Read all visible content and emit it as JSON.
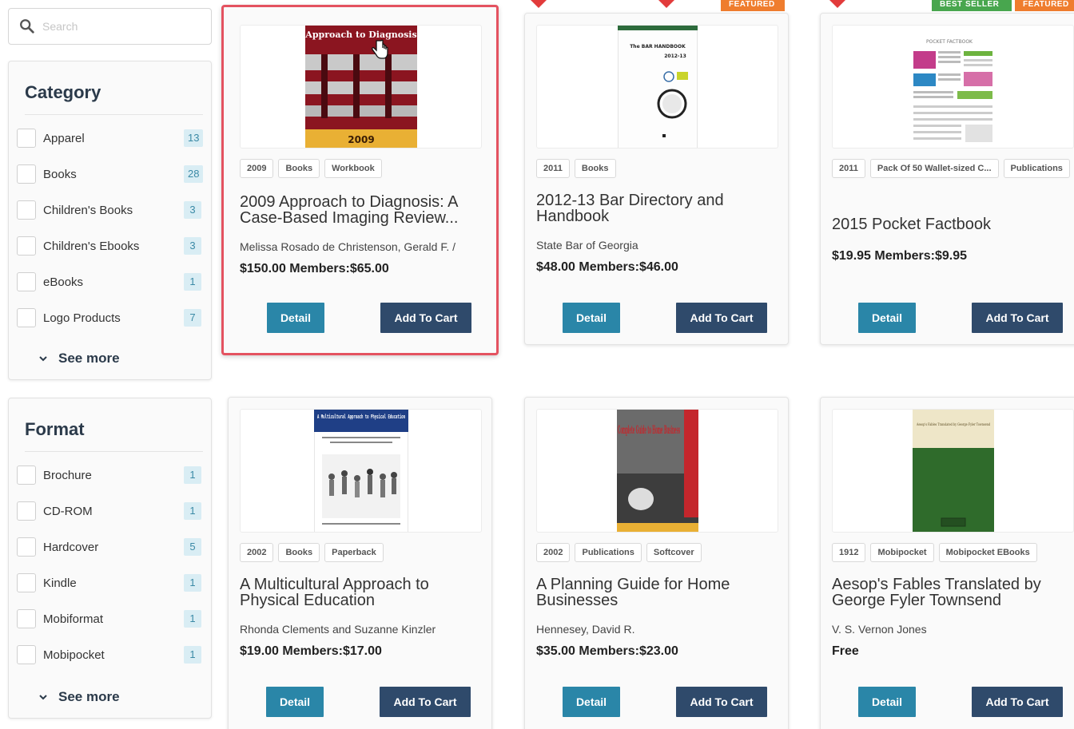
{
  "search": {
    "placeholder": "Search"
  },
  "category": {
    "title": "Category",
    "items": [
      {
        "label": "Apparel",
        "count": "13"
      },
      {
        "label": "Books",
        "count": "28"
      },
      {
        "label": "Children's Books",
        "count": "3"
      },
      {
        "label": "Children's Ebooks",
        "count": "3"
      },
      {
        "label": "eBooks",
        "count": "1"
      },
      {
        "label": "Logo Products",
        "count": "7"
      }
    ],
    "see_more": "See more"
  },
  "format": {
    "title": "Format",
    "items": [
      {
        "label": "Brochure",
        "count": "1"
      },
      {
        "label": "CD-ROM",
        "count": "1"
      },
      {
        "label": "Hardcover",
        "count": "5"
      },
      {
        "label": "Kindle",
        "count": "1"
      },
      {
        "label": "Mobiformat",
        "count": "1"
      },
      {
        "label": "Mobipocket",
        "count": "1"
      }
    ],
    "see_more": "See more"
  },
  "badges": {
    "featured": "FEATURED",
    "best_seller": "BEST SELLER"
  },
  "buttons": {
    "detail": "Detail",
    "add_to_cart": "Add To Cart"
  },
  "products": [
    {
      "tags": [
        "2009",
        "Books",
        "Workbook"
      ],
      "title": "2009 Approach to Diagnosis: A Case-Based Imaging Review...",
      "author": "Melissa Rosado de Christenson, Gerald F. /",
      "price": "$150.00 Members:$65.00",
      "cover_title": "Approach to Diagnosis",
      "cover_year": "2009"
    },
    {
      "tags": [
        "2011",
        "Books"
      ],
      "title": "2012-13 Bar Directory and Handbook",
      "author": "State Bar of Georgia",
      "price": "$48.00 Members:$46.00",
      "cover_title": "The BAR HANDBOOK",
      "cover_year": "2012-13"
    },
    {
      "tags": [
        "2011",
        "Pack Of 50 Wallet-sized C...",
        "Publications"
      ],
      "title": "2015 Pocket Factbook",
      "author": "",
      "price": "$19.95 Members:$9.95",
      "cover_title": "POCKET FACTBOOK"
    },
    {
      "tags": [
        "2002",
        "Books",
        "Paperback"
      ],
      "title": "A Multicultural Approach to Physical Education",
      "author": "Rhonda Clements and Suzanne Kinzler",
      "price": "$19.00 Members:$17.00",
      "cover_title": "A Multicultural Approach to Physical Education"
    },
    {
      "tags": [
        "2002",
        "Publications",
        "Softcover"
      ],
      "title": "A Planning Guide for Home Businesses",
      "author": "Hennesey, David R.",
      "price": "$35.00 Members:$23.00",
      "cover_title": "Complete Guide to Home Business"
    },
    {
      "tags": [
        "1912",
        "Mobipocket",
        "Mobipocket EBooks"
      ],
      "title": "Aesop's Fables Translated by George Fyler Townsend",
      "author": "V. S. Vernon Jones",
      "price": "Free",
      "cover_title": "Aesop's Fables Translated by George Fyler Townsend"
    }
  ]
}
